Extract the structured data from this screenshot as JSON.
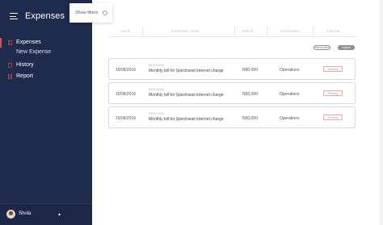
{
  "app": {
    "title": "Expenses"
  },
  "sidebar": {
    "items": [
      {
        "label": "Expenses",
        "icon": "book-icon",
        "active": true
      },
      {
        "label": "New Expense",
        "sub": true
      },
      {
        "label": "History",
        "icon": "history-icon"
      },
      {
        "label": "Report",
        "icon": "report-icon"
      }
    ],
    "user": {
      "name": "Shola"
    }
  },
  "filters": {
    "label": "Show filters"
  },
  "table": {
    "columns": [
      "DATE",
      "EXPENSE ITEM",
      "PRICE",
      "CATEGORY",
      "STATUS"
    ],
    "toggles": [
      "Reimbursed",
      "Unpaid"
    ],
    "rows": [
      {
        "date": "15/08/2016",
        "code": "#EXP12345",
        "item": "Monthly bill for Spectranet internet charge",
        "price": "N50,000",
        "category": "Operations",
        "status": "Pending"
      },
      {
        "date": "15/08/2016",
        "code": "#EXP12345",
        "item": "Monthly bill for Spectranet internet charge",
        "price": "N50,000",
        "category": "Operations",
        "status": "Pending"
      },
      {
        "date": "15/08/2016",
        "code": "#EXP12345",
        "item": "Monthly bill for Spectranet internet charge",
        "price": "N50,000",
        "category": "Operations",
        "status": "Pending"
      }
    ]
  },
  "colors": {
    "sidebar_bg": "#1f2b4d",
    "accent": "#e04b4b",
    "status": "#e58f86"
  }
}
